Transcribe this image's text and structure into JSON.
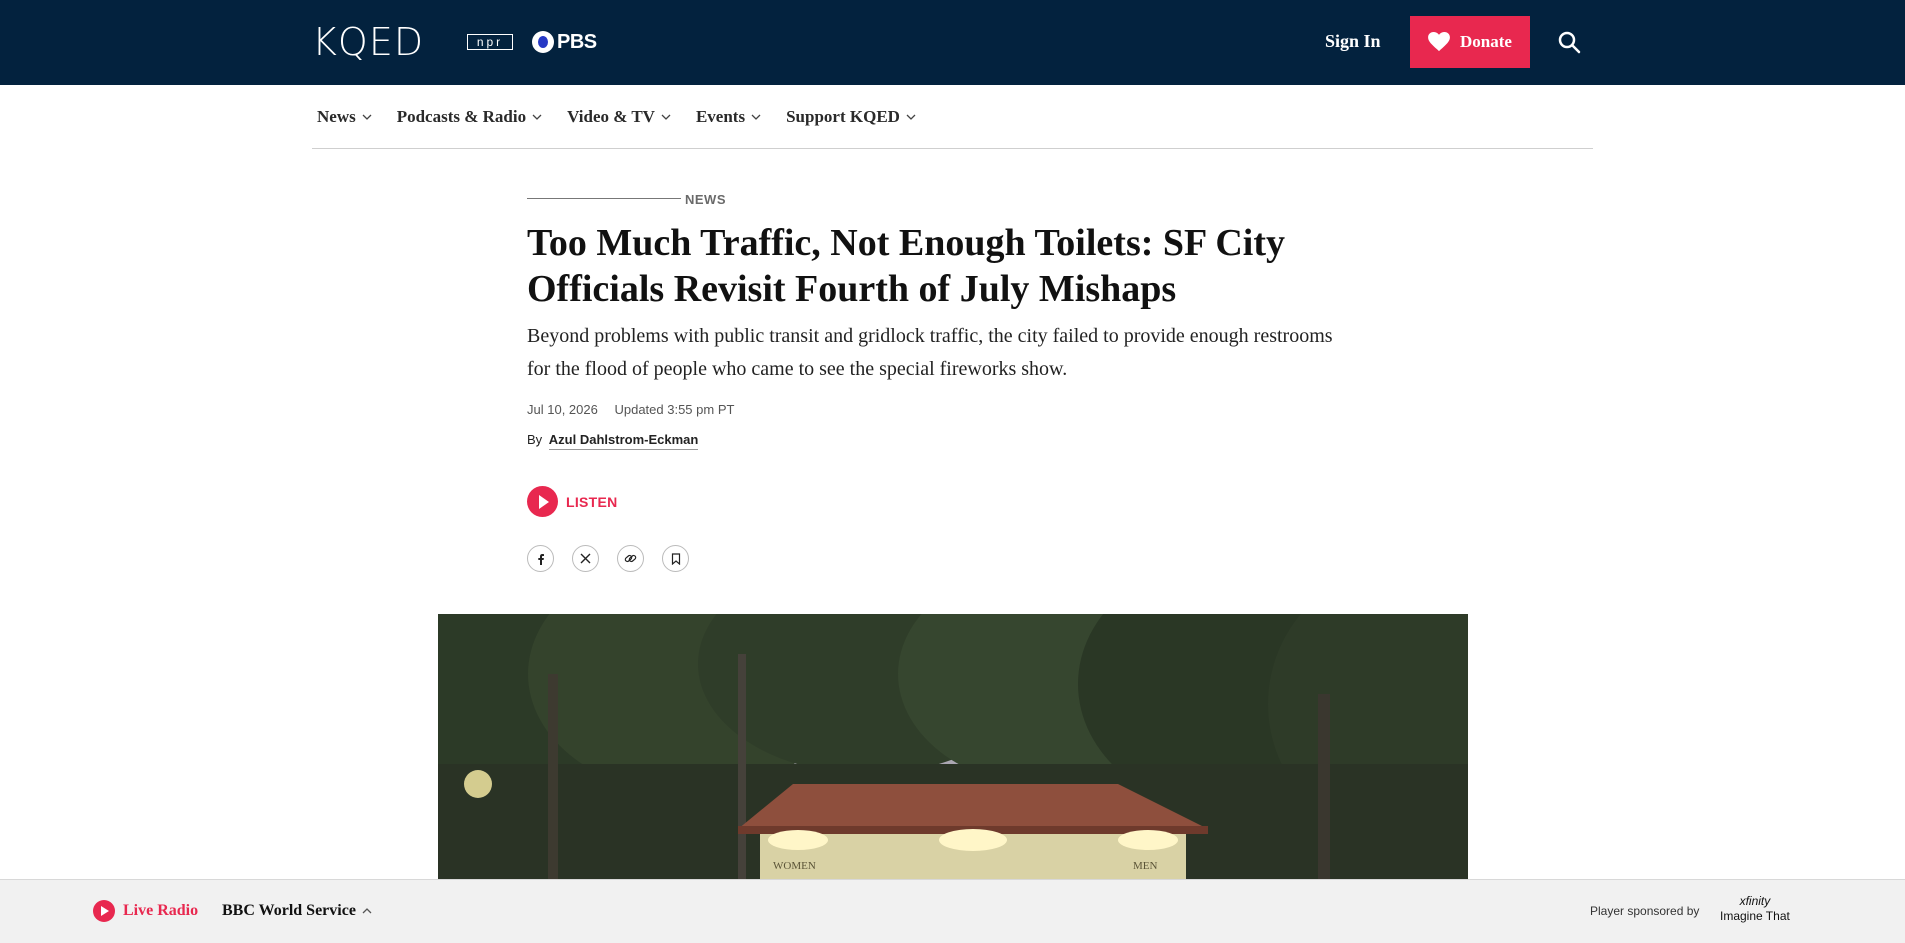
{
  "header": {
    "logo": "KQED",
    "partner_npr": "npr",
    "partner_pbs": "PBS",
    "sign_in": "Sign In",
    "donate": "Donate"
  },
  "nav": {
    "items": [
      {
        "label": "News"
      },
      {
        "label": "Podcasts & Radio"
      },
      {
        "label": "Video & TV"
      },
      {
        "label": "Events"
      },
      {
        "label": "Support KQED"
      }
    ]
  },
  "article": {
    "kicker": "NEWS",
    "headline": "Too Much Traffic, Not Enough Toilets: SF City Officials Revisit Fourth of July Mishaps",
    "dek": "Beyond problems with public transit and gridlock traffic, the city failed to provide enough restrooms for the flood of people who came to see the special fireworks show.",
    "date": "Jul 10, 2026",
    "updated": "Updated 3:55 pm PT",
    "by": "By",
    "author": "Azul Dahlstrom-Eckman",
    "listen": "LISTEN",
    "photo_signs": {
      "left": "WOMEN",
      "right": "MEN"
    }
  },
  "player": {
    "live": "Live Radio",
    "station": "BBC World Service",
    "sponsor_label": "Player sponsored by",
    "sponsor_brand": "xfinity",
    "sponsor_tagline": "Imagine That"
  },
  "colors": {
    "header_bg": "#03223e",
    "accent": "#e8284f"
  },
  "icons": {
    "search": "search-icon",
    "heart": "heart-icon",
    "share": [
      "facebook-icon",
      "x-icon",
      "link-icon",
      "bookmark-icon"
    ]
  }
}
